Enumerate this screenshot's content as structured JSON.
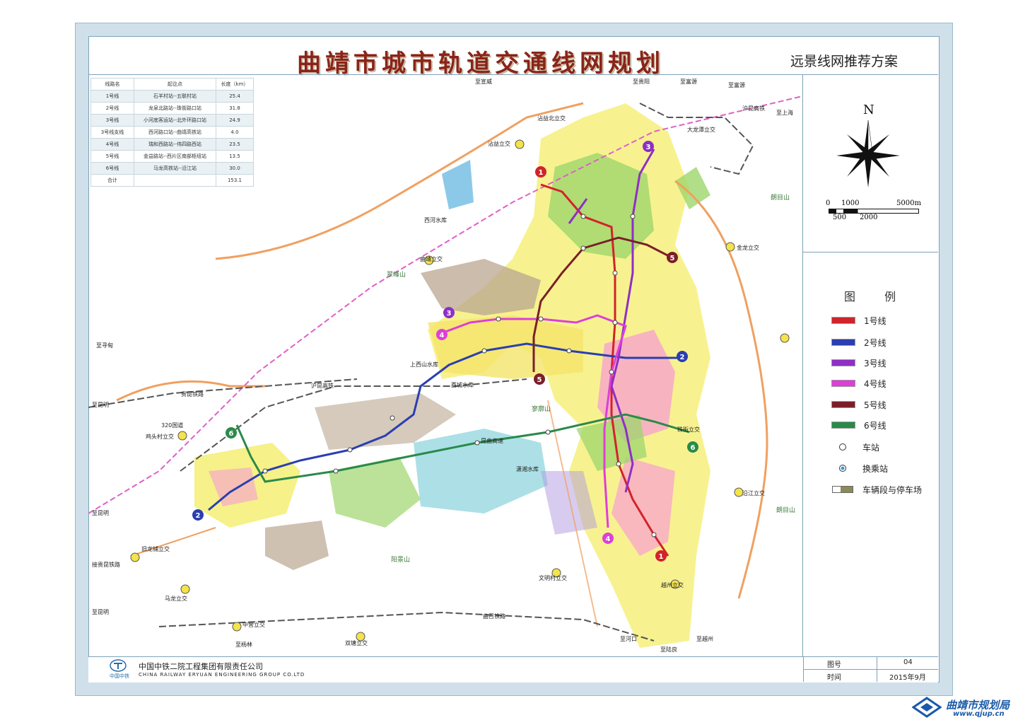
{
  "title": "曲靖市城市轨道交通线网规划",
  "subtitle": "远景线网推荐方案",
  "colors": {
    "line1": "#d2232a",
    "line2": "#2b3fb0",
    "line3": "#8e2fc6",
    "line4": "#dd3fd8",
    "line5": "#7a1f2a",
    "line6": "#2a8a4a",
    "frame": "#cfe0ea",
    "title": "#8a2418"
  },
  "table": {
    "headers": [
      "线路名",
      "起讫点",
      "长度（km）"
    ],
    "rows": [
      [
        "1号线",
        "石羊村站--五联村站",
        "25.4"
      ],
      [
        "2号线",
        "龙泉北路站--珠街路口站",
        "31.8"
      ],
      [
        "3号线",
        "小河底客运站--北外环路口站",
        "24.9"
      ],
      [
        "3号线支线",
        "西河路口站--曲靖高铁站",
        "4.0"
      ],
      [
        "4号线",
        "瑞和西路站--伟四路西站",
        "23.5"
      ],
      [
        "5号线",
        "金益路站--西片区南部枢纽站",
        "13.5"
      ],
      [
        "6号线",
        "马龙高铁站--沿江站",
        "30.0"
      ],
      [
        "合计",
        "",
        "153.1"
      ]
    ]
  },
  "compass": {
    "north": "N",
    "scale_labels_top": [
      "0",
      "1000",
      "5000m"
    ],
    "scale_labels_bottom": [
      "500",
      "2000"
    ]
  },
  "legend": {
    "title": "图 例",
    "items": [
      {
        "label": "1号线",
        "color": "#d2232a",
        "kind": "line"
      },
      {
        "label": "2号线",
        "color": "#2b3fb0",
        "kind": "line"
      },
      {
        "label": "3号线",
        "color": "#8e2fc6",
        "kind": "line"
      },
      {
        "label": "4号线",
        "color": "#dd3fd8",
        "kind": "line"
      },
      {
        "label": "5号线",
        "color": "#7a1f2a",
        "kind": "line"
      },
      {
        "label": "6号线",
        "color": "#2a8a4a",
        "kind": "line"
      },
      {
        "label": "车站",
        "kind": "station"
      },
      {
        "label": "换乘站",
        "kind": "transfer"
      },
      {
        "label": "车辆段与停车场",
        "kind": "depot"
      }
    ]
  },
  "map_labels": [
    {
      "text": "至宣威"
    },
    {
      "text": "至贵阳"
    },
    {
      "text": "至富源"
    },
    {
      "text": "至富源"
    },
    {
      "text": "至上海"
    },
    {
      "text": "沾益北立交"
    },
    {
      "text": "沾益立交"
    },
    {
      "text": "大龙潭立交"
    },
    {
      "text": "沪昆高铁"
    },
    {
      "text": "朗目山"
    },
    {
      "text": "西河水库"
    },
    {
      "text": "曲靖立交"
    },
    {
      "text": "翠峰山"
    },
    {
      "text": "金龙立交"
    },
    {
      "text": "至寻甸"
    },
    {
      "text": "上西山水库"
    },
    {
      "text": "西城水库"
    },
    {
      "text": "沪昆高铁"
    },
    {
      "text": "贵昆铁路"
    },
    {
      "text": "至昆明"
    },
    {
      "text": "320国道"
    },
    {
      "text": "鸡头村立交"
    },
    {
      "text": "昆曲高速"
    },
    {
      "text": "寥廓山"
    },
    {
      "text": "潇湘水库"
    },
    {
      "text": "珠街立交"
    },
    {
      "text": "沿江立交"
    },
    {
      "text": "朗目山"
    },
    {
      "text": "至昆明"
    },
    {
      "text": "旧龙铺立交"
    },
    {
      "text": "接贵昆铁路"
    },
    {
      "text": "阳景山"
    },
    {
      "text": "马龙立交"
    },
    {
      "text": "文明村立交"
    },
    {
      "text": "越州立交"
    },
    {
      "text": "至昆明"
    },
    {
      "text": "曲召铁路"
    },
    {
      "text": "中营立交"
    },
    {
      "text": "至杨林"
    },
    {
      "text": "双塘立交"
    },
    {
      "text": "至河口"
    },
    {
      "text": "至陆良"
    },
    {
      "text": "至越州"
    }
  ],
  "footer": {
    "company_cn": "中国中铁二院工程集团有限责任公司",
    "company_en": "CHINA RAILWAY ERYUAN ENGINEERING GROUP CO.LTD",
    "logo_text": "中国中铁",
    "drawing_no_label": "图号",
    "drawing_no": "04",
    "time_label": "时间",
    "time": "2015年9月"
  },
  "watermark": {
    "cn": "曲靖市规划局",
    "url": "www.qjup.cn"
  }
}
